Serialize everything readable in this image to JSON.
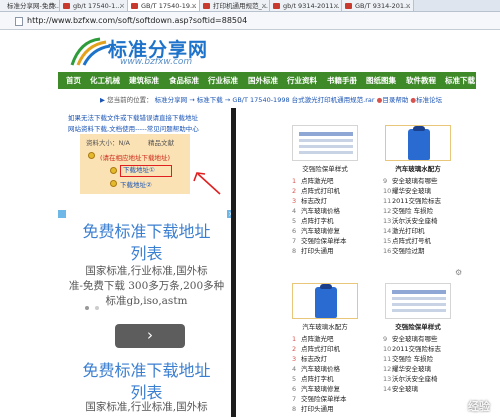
{
  "browser": {
    "tabs": [
      {
        "label": "标准分享网-免费..."
      },
      {
        "label": "gb/t 17540-1..."
      },
      {
        "label": "GB/T 17540-19..."
      },
      {
        "label": "打印机通用规范_..."
      },
      {
        "label": "gb/t 9314-2011..."
      },
      {
        "label": "GB/T 9314-201..."
      }
    ],
    "url": "http://www.bzfxw.com/soft/softdown.asp?softid=88504"
  },
  "header": {
    "logo_text": "标准分享网",
    "logo_url": "www.bzfxw.com"
  },
  "nav": {
    "items": [
      "首页",
      "化工机械",
      "建筑标准",
      "食品标准",
      "行业标准",
      "国外标准",
      "行业资料",
      "书籍手册",
      "图纸图集",
      "软件教程",
      "标准下载"
    ]
  },
  "breadcrumb": {
    "prefix": "您当前的位置：",
    "path": "标准分享网 → 标准下载 → GB/T 17540-1998 台式激光打印机通用规范.rar",
    "extra1": "目录帮助",
    "extra2": "标准论坛"
  },
  "download": {
    "notice1": "如果无法下载文件或下载错误请直接下载地址",
    "notice2": "网站资料下载,文档使用-----常见问题帮助中心",
    "size_label": "资料大小：N/A",
    "rating_label": "精品文献",
    "hint": "(请在相应地址下载地址)",
    "link1": "下载地址①",
    "link2": "下载地址②"
  },
  "ad": {
    "title1": "免费标准下载地址",
    "title2": "列表",
    "body1": "国家标准,行业标准,国外标",
    "body2": "准-免费下载 300多万条,200多种",
    "body3": "标准gb,iso,astm",
    "next_arrow": "›",
    "title3": "免费标准下载地址",
    "title4": "列表",
    "body4": "国家标准,行业标准,国外标"
  },
  "products": {
    "top_left_caption": "交强险保单样式",
    "top_right_caption": "汽车玻璃水配方",
    "bottom_left_caption": "汽车玻璃水配方",
    "bottom_right_caption": "交强险保单样式",
    "list_top_left": [
      "点阵激光吧",
      "点阵式打印机",
      "标志改灯",
      "汽车玻璃价格",
      "点阵打字机",
      "汽车玻璃修复",
      "交强险保单样本",
      "打印头通用"
    ],
    "list_top_right": [
      "安全玻璃有哪些",
      "耀华安全玻璃",
      "2011交强险标志",
      "交强险 车损险",
      "沃尔沃安全座椅",
      "激光打印机",
      "点阵式打号机",
      "交强险过期"
    ],
    "list_top_numbers_left": [
      "1",
      "2",
      "3",
      "4",
      "5",
      "6",
      "7",
      "8"
    ],
    "list_top_numbers_right": [
      "9",
      "10",
      "11",
      "12",
      "13",
      "14",
      "15",
      "16"
    ],
    "list_bottom_left": [
      "点阵激光吧",
      "点阵式打印机",
      "标志改灯",
      "汽车玻璃价格",
      "点阵打字机",
      "汽车玻璃修复",
      "交强险保单样本",
      "打印头通用"
    ],
    "list_bottom_right": [
      "安全玻璃有哪些",
      "2011交强险标志",
      "交强险 车损险",
      "耀华安全玻璃",
      "沃尔沃安全座椅",
      "安全玻璃"
    ],
    "list_bottom_numbers_left": [
      "1",
      "2",
      "3",
      "4",
      "5",
      "6",
      "7",
      "8"
    ],
    "list_bottom_numbers_right": [
      "9",
      "10",
      "11",
      "12",
      "13",
      "14"
    ]
  },
  "watermark": "经验",
  "colors": {
    "nav_green": "#3e8a28",
    "link_blue": "#1a54b5",
    "ad_blue": "#3b7fd1",
    "alert_red": "#e02020",
    "info_bg": "#fbe2b4"
  }
}
